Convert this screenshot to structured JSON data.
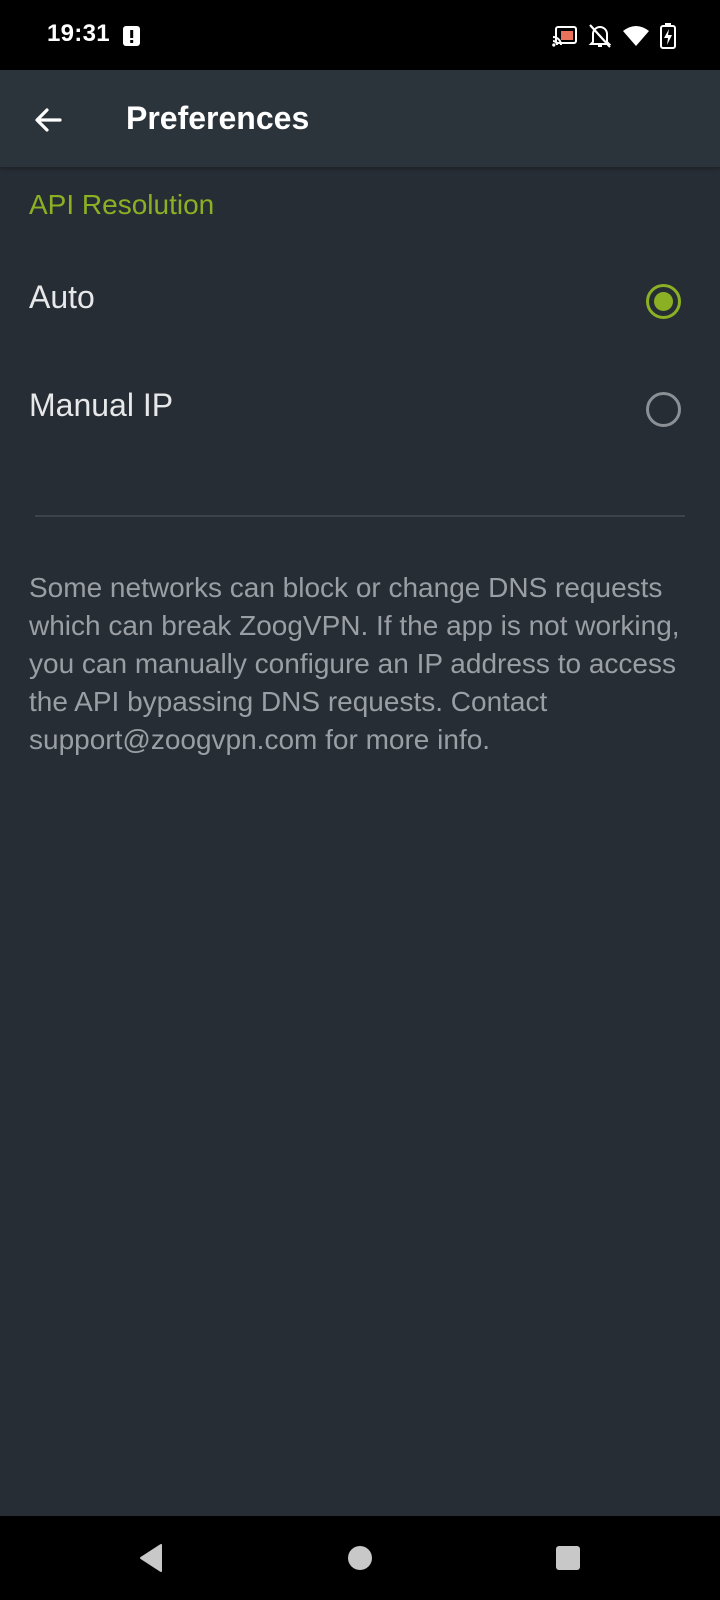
{
  "status_bar": {
    "time": "19:31",
    "icons": [
      "alert-icon",
      "cast-icon",
      "notifications-off-icon",
      "wifi-icon",
      "battery-charging-icon"
    ]
  },
  "app_bar": {
    "title": "Preferences",
    "back_icon": "arrow-back-icon"
  },
  "settings": {
    "section_title": "API Resolution",
    "options": [
      {
        "label": "Auto",
        "selected": true
      },
      {
        "label": "Manual IP",
        "selected": false
      }
    ],
    "help_text": "Some networks can block or change DNS requests which can break ZoogVPN. If the app is not working, you can manually configure an IP address to access the API bypassing DNS requests. Contact support@zoogvpn.com for more info."
  },
  "nav_bar": {
    "buttons": [
      "back-triangle-icon",
      "home-circle-icon",
      "recents-square-icon"
    ]
  },
  "colors": {
    "accent": "#8bb024",
    "background": "#272d34",
    "app_bar": "#2c343b"
  }
}
